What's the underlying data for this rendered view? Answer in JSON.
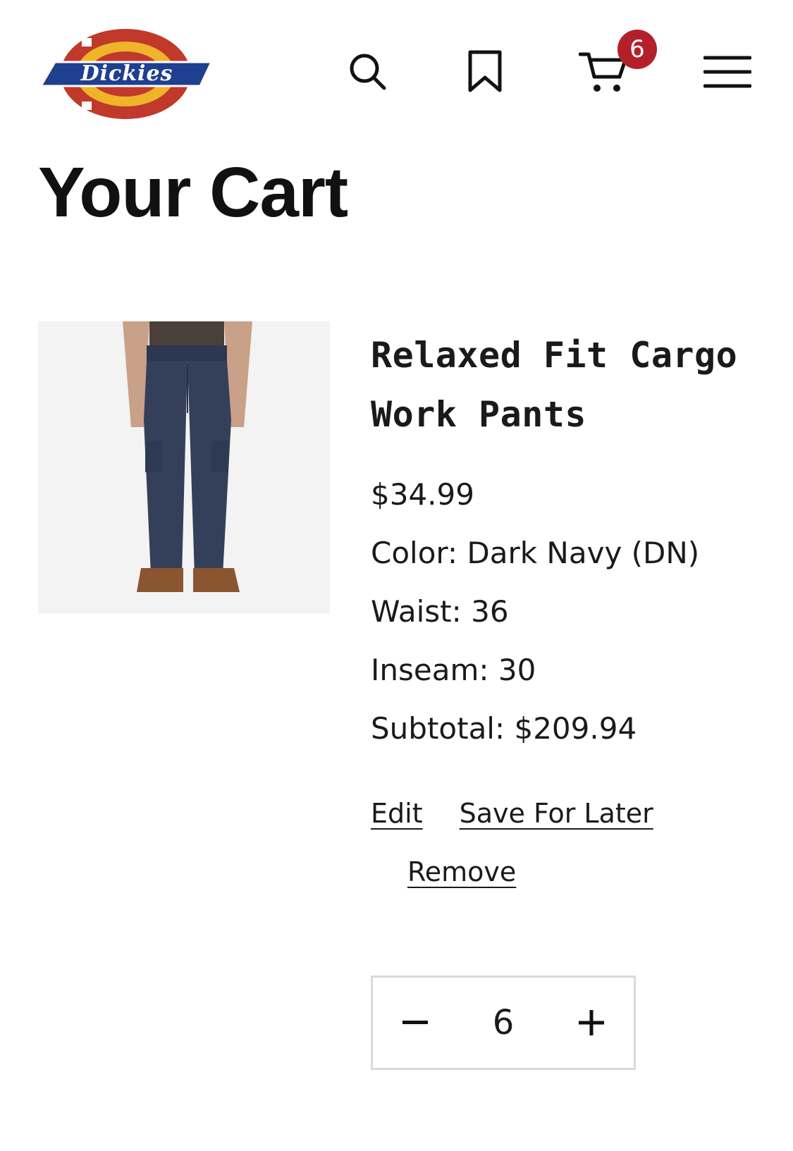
{
  "header": {
    "logo_text": "Dickies",
    "cart_count": "6",
    "icons": [
      "search-icon",
      "bookmark-icon",
      "cart-icon",
      "menu-icon"
    ]
  },
  "page": {
    "title": "Your Cart"
  },
  "cart_item": {
    "name_line1": "Relaxed Fit Cargo",
    "name_line2": "Work Pants",
    "price": "$34.99",
    "color": "Color: Dark Navy (DN)",
    "waist": "Waist: 36",
    "inseam": "Inseam: 30",
    "subtotal": "Subtotal: $209.94",
    "actions": {
      "edit": "Edit",
      "save_for_later": "Save For Later",
      "remove": "Remove"
    },
    "quantity": {
      "value": "6",
      "decrease": "−",
      "increase": "+"
    }
  },
  "colors": {
    "badge": "#b3202a",
    "text": "#1a1a1a",
    "border": "#d9d9d9",
    "logo_red": "#c0392b",
    "logo_blue": "#1f3f8f",
    "logo_gold": "#f0b429"
  }
}
